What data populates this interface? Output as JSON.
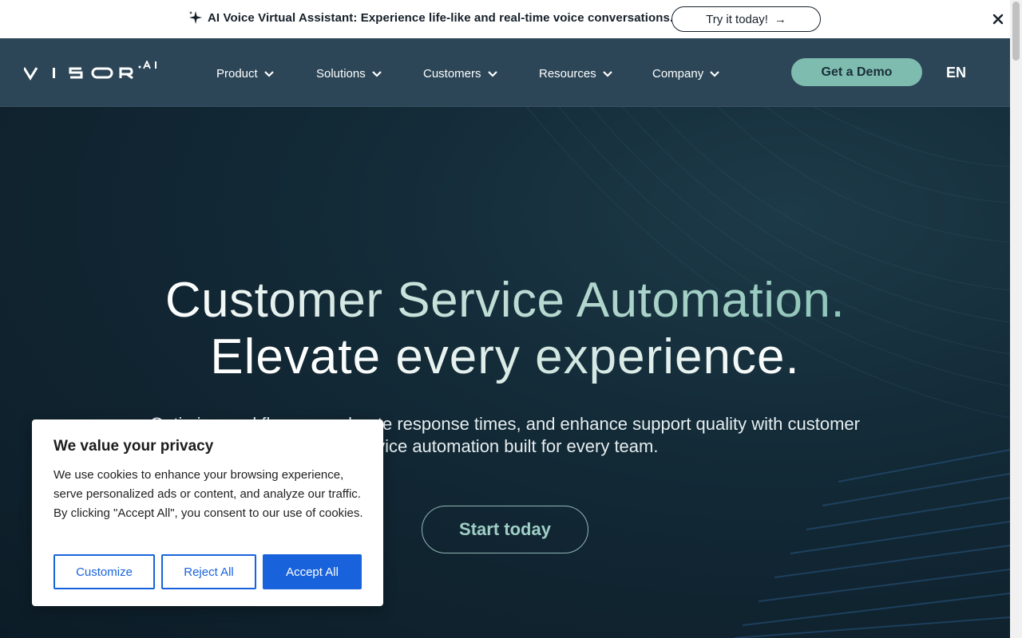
{
  "announcement": {
    "message": "AI Voice Virtual Assistant: Experience life-like and real-time voice conversations.",
    "cta_label": "Try it today!",
    "cta_arrow": "→"
  },
  "nav": {
    "logo_text": "VISOR",
    "logo_suffix": ".AI",
    "items": [
      {
        "label": "Product"
      },
      {
        "label": "Solutions"
      },
      {
        "label": "Customers"
      },
      {
        "label": "Resources"
      },
      {
        "label": "Company"
      }
    ],
    "demo_label": "Get a Demo",
    "language": "EN"
  },
  "hero": {
    "title_line1": "Customer Service Automation.",
    "title_line2": "Elevate every experience.",
    "subtitle": "Optimize workflows, accelerate response times, and enhance support quality with customer service automation built for every team.",
    "cta_label": "Start today"
  },
  "cookie": {
    "title": "We value your privacy",
    "text": "We use cookies to enhance your browsing experience, serve personalized ads or content, and analyze our traffic. By clicking \"Accept All\", you consent to our use of cookies.",
    "customize_label": "Customize",
    "reject_label": "Reject All",
    "accept_label": "Accept All"
  },
  "colors": {
    "nav_bg": "#2c4657",
    "accent": "#7fbcb0",
    "cookie_primary": "#1863dc"
  }
}
